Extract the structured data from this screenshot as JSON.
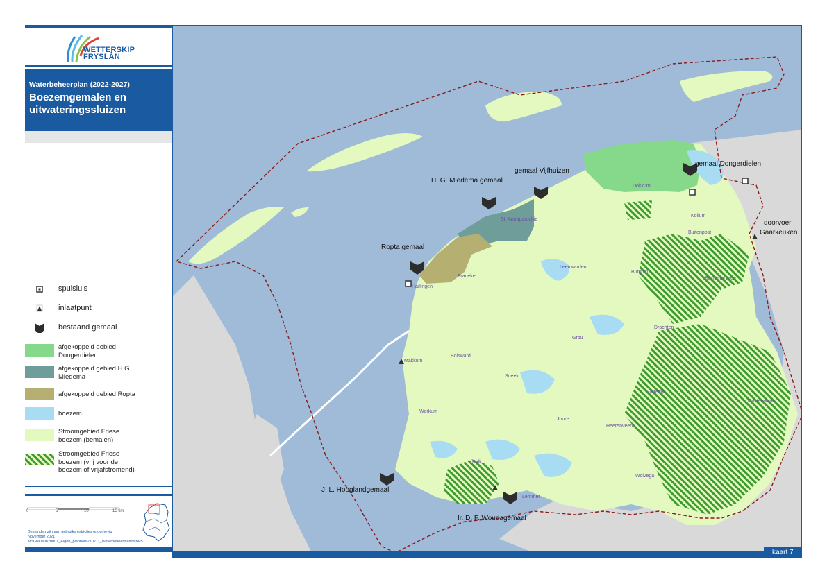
{
  "organization": {
    "logo_line1": "WETTERSKIP",
    "logo_line2": "FRYSLÂN"
  },
  "header": {
    "subtitle": "Waterbeheerplan (2022-2027)",
    "title_line1": "Boezemgemalen en",
    "title_line2": "uitwateringssluizen"
  },
  "legend": {
    "spuisluis": "spuisluis",
    "inlaatpunt": "inlaatpunt",
    "bestaand_gemaal": "bestaand gemaal",
    "dongerdielen_1": "afgekoppeld gebied",
    "dongerdielen_2": "Dongerdielen",
    "miedema_1": "afgekoppeld gebied H.G.",
    "miedema_2": "Miedema",
    "ropta": "afgekoppeld gebied Ropta",
    "boezem": "boezem",
    "bemalen_1": "Stroomgebied Friese",
    "bemalen_2": "boezem (bemalen)",
    "vrij_1": "Stroomgebied Friese",
    "vrij_2": "boezem (vrij voor de",
    "vrij_3": "boezem of vrijafstromend)"
  },
  "scale": {
    "t0": "0",
    "t5": "5",
    "t10": "10",
    "t15": "15 km"
  },
  "footer_notes": {
    "line1": "Bestanden zijn aan gebruiksrestricties onderhevig",
    "line2": "November 2021",
    "line3": "M:\\GisData\\20001_Eigen_plannen\\210211_Waterbeheerplan\\WBP5"
  },
  "map_labels": {
    "dongerdielen": "gemaal Dongerdielen",
    "vijfhuizen": "gemaal Vijfhuizen",
    "miedema": "H. G. Miedema gemaal",
    "ropta": "Ropta gemaal",
    "gaarkeuken_1": "doorvoer",
    "gaarkeuken_2": "Gaarkeuken",
    "hooglandgemaal": "J. L. Hooglandgemaal",
    "woudagemaal": "Ir. D. F. Woudagemaal"
  },
  "towns": {
    "dokkum": "Dokkum",
    "kollum": "Kollum",
    "buitenpost": "Buitenpost",
    "st_anna": "St. Annaparochie",
    "leeuwarden": "Leeuwarden",
    "franeker": "Franeker",
    "harlingen": "Harlingen",
    "burgum": "Burgum",
    "buchtstervaart": "Buchtsterveen",
    "drachten": "Drachten",
    "grou": "Grou",
    "bolsward": "Bolsward",
    "makkum": "Makkum",
    "sneek": "Sneek",
    "gorredijk": "Gorredijk",
    "oosterwolde": "Oosterwolde",
    "workum": "Workum",
    "joure": "Joure",
    "heerenveen": "Heerenveen",
    "balk": "Balk",
    "wolvega": "Wolvega",
    "lemmer": "Lemmer"
  },
  "map_badge": "kaart 7",
  "colors": {
    "brand_blue": "#1a5aa0",
    "sea": "#9fbbd8",
    "land_other": "#d9d9d9",
    "boezem": "#a8dcf2",
    "bemalen": "#e4f9c0",
    "dongerdielen": "#86d98a",
    "miedema": "#6f9e9a",
    "ropta": "#b5b071",
    "hatch": "#3d9a2e",
    "boundary": "#8b1a1a"
  }
}
